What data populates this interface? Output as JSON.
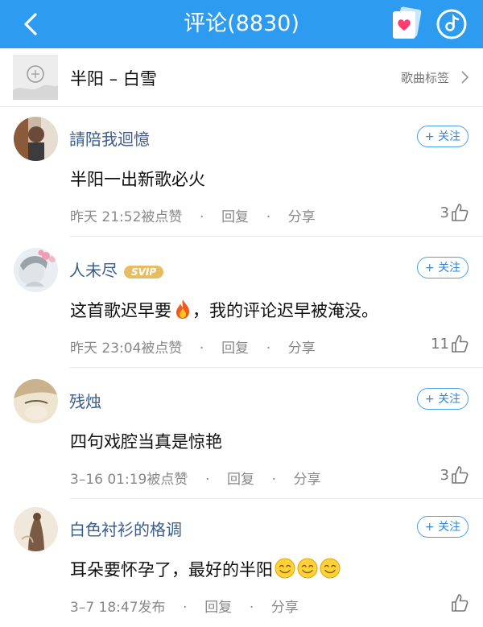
{
  "header": {
    "title": "评论(8830)"
  },
  "song": {
    "title": "半阳 – 白雪",
    "tag_label": "歌曲标签"
  },
  "comments": [
    {
      "user": "請陪我迴憶",
      "follow": "+ 关注",
      "text": "半阳一出新歌必火",
      "date": "昨天 21:52",
      "liked": "被点赞",
      "dot1": "·",
      "reply": "回复",
      "dot2": "·",
      "share": "分享",
      "likes": "3"
    },
    {
      "user": "人未尽",
      "badge": "SVIP",
      "follow": "+ 关注",
      "text_before": "这首歌迟早要",
      "text_after": "，我的评论迟早被淹没。",
      "date": "昨天 23:04",
      "liked": "被点赞",
      "dot1": "·",
      "reply": "回复",
      "dot2": "·",
      "share": "分享",
      "likes": "11"
    },
    {
      "user": "残烛",
      "follow": "+ 关注",
      "text": "四句戏腔当真是惊艳",
      "date": "3–16 01:19",
      "liked": "被点赞",
      "dot1": "·",
      "reply": "回复",
      "dot2": "·",
      "share": "分享",
      "likes": "3"
    },
    {
      "user": "白色衬衫的格调",
      "follow": "+ 关注",
      "text": "耳朵要怀孕了，最好的半阳",
      "date": "3–7 18:47",
      "liked": "发布",
      "dot1": "·",
      "reply": "回复",
      "dot2": "·",
      "share": "分享",
      "likes": ""
    }
  ],
  "colors": {
    "topbar": "#2d9bf0",
    "username": "#3b5c8c",
    "follow": "#2e86d8",
    "svip": "#e7bd64"
  },
  "icons": [
    "back-arrow-icon",
    "heart-card-icon",
    "music-disc-icon",
    "chevron-right-icon",
    "thumbs-up-icon",
    "fire-emoji",
    "smile-emoji"
  ]
}
